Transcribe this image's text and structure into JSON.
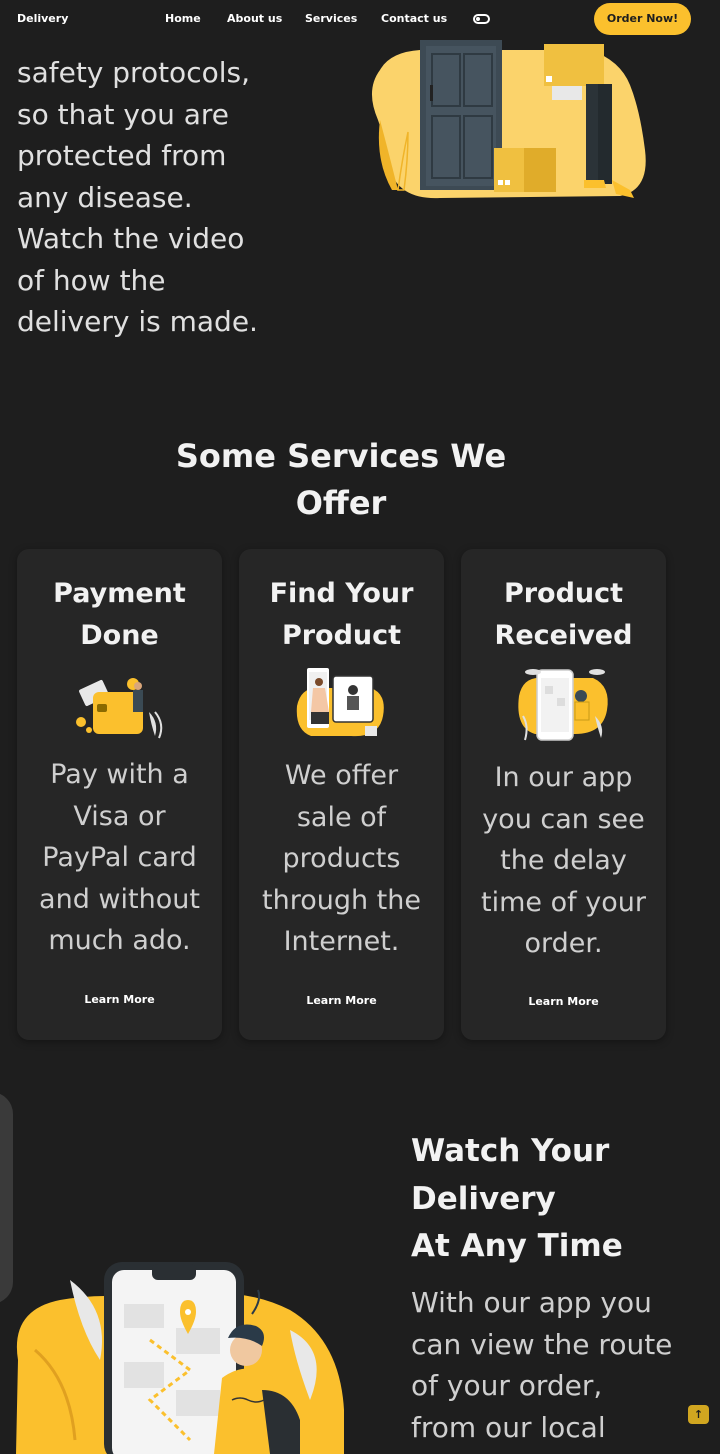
{
  "nav": {
    "brand": "Delivery",
    "links": [
      "Home",
      "About us",
      "Services",
      "Contact us"
    ],
    "order_button": "Order Now!"
  },
  "hero": {
    "lines": [
      "safety protocols,",
      "so that you are",
      "protected from",
      "any disease.",
      "Watch the video",
      "of how the",
      "delivery is made."
    ]
  },
  "services": {
    "title_lines": [
      "Some Services We",
      "Offer"
    ],
    "cards": [
      {
        "title_lines": [
          "Payment",
          "Done"
        ],
        "desc_lines": [
          "Pay with a",
          "Visa or",
          "PayPal card",
          "and without",
          "much ado."
        ],
        "link": "Learn More",
        "icon": "wallet-payment-icon"
      },
      {
        "title_lines": [
          "Find Your",
          "Product"
        ],
        "desc_lines": [
          "We offer",
          "sale of",
          "products",
          "through the",
          "Internet."
        ],
        "link": "Learn More",
        "icon": "online-shopping-icon"
      },
      {
        "title_lines": [
          "Product",
          "Received"
        ],
        "desc_lines": [
          "In our app",
          "you can see",
          "the delay",
          "time of your",
          "order."
        ],
        "link": "Learn More",
        "icon": "phone-delivery-icon"
      }
    ]
  },
  "watch": {
    "title_lines": [
      "Watch Your",
      "Delivery",
      "At Any Time"
    ],
    "desc_lines": [
      "With our app you",
      "can view the route",
      "of your order,",
      "from our local"
    ]
  },
  "colors": {
    "accent": "#fbc02d",
    "background": "#1e1e1e",
    "card": "#262626"
  },
  "icons": {
    "scroll_top": "arrow-up-icon",
    "theme_toggle": "toggle-icon"
  }
}
